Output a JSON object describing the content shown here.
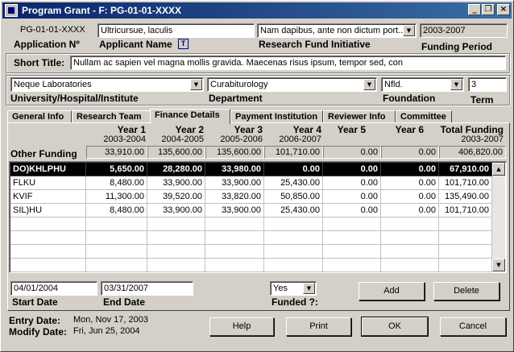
{
  "window": {
    "title": "Program Grant - F: PG-01-01-XXXX",
    "minimize_glyph": "_",
    "restore_glyph": "❐",
    "close_glyph": "×"
  },
  "header": {
    "application_no_value": "PG-01-01-XXXX",
    "application_no_label": "Application Nº",
    "applicant_name_value": "Ultricursue, laculis",
    "applicant_name_label": "Applicant Name",
    "applicant_icon_glyph": "T",
    "research_fund_value": "Nam dapibus, ante non dictum port...",
    "research_fund_label": "Research Fund Initiative",
    "funding_period_value": "2003-2007",
    "funding_period_label": "Funding Period"
  },
  "short_title": {
    "label": "Short Title:",
    "value": "Nullam ac sapien vel magna mollis gravida. Maecenas risus ipsum, tempor sed, con"
  },
  "institution": {
    "university_value": "Neque Laboratories",
    "university_label": "University/Hospital/Institute",
    "department_value": "Curabiturology",
    "department_label": "Department",
    "foundation_value": "Nfld.",
    "foundation_label": "Foundation",
    "term_value": "3",
    "term_label": "Term"
  },
  "tabs": [
    {
      "label": "General Info"
    },
    {
      "label": "Research Team"
    },
    {
      "label": "Finance Details"
    },
    {
      "label": "Payment Institution"
    },
    {
      "label": "Reviewer Info"
    },
    {
      "label": "Committee"
    }
  ],
  "finance": {
    "columns": [
      {
        "year": "Year 1",
        "period": "2003-2004"
      },
      {
        "year": "Year 2",
        "period": "2004-2005"
      },
      {
        "year": "Year 3",
        "period": "2005-2006"
      },
      {
        "year": "Year 4",
        "period": "2006-2007"
      },
      {
        "year": "Year 5",
        "period": ""
      },
      {
        "year": "Year 6",
        "period": ""
      },
      {
        "year": "Total Funding",
        "period": "2003-2007"
      }
    ],
    "other_funding_label": "Other Funding",
    "other_funding": [
      "33,910.00",
      "135,600.00",
      "135,600.00",
      "101,710.00",
      "0.00",
      "0.00",
      "406,820.00"
    ],
    "rows": [
      {
        "name": "DO)KHLPHU",
        "values": [
          "5,650.00",
          "28,280.00",
          "33,980.00",
          "0.00",
          "0.00",
          "0.00",
          "67,910.00"
        ]
      },
      {
        "name": "FLKU",
        "values": [
          "8,480.00",
          "33,900.00",
          "33,900.00",
          "25,430.00",
          "0.00",
          "0.00",
          "101,710.00"
        ]
      },
      {
        "name": "KVIF",
        "values": [
          "11,300.00",
          "39,520.00",
          "33,820.00",
          "50,850.00",
          "0.00",
          "0.00",
          "135,490.00"
        ]
      },
      {
        "name": "SIL)HU",
        "values": [
          "8,480.00",
          "33,900.00",
          "33,900.00",
          "25,430.00",
          "0.00",
          "0.00",
          "101,710.00"
        ]
      }
    ],
    "scroll_up_glyph": "▲",
    "scroll_down_glyph": "▼",
    "start_date_value": "04/01/2004",
    "start_date_label": "Start Date",
    "end_date_value": "03/31/2007",
    "end_date_label": "End Date",
    "funded_value": "Yes",
    "funded_label": "Funded ?:",
    "add_label": "Add",
    "delete_label": "Delete"
  },
  "footer": {
    "entry_date_label": "Entry Date:",
    "entry_date_value": "Mon, Nov 17, 2003",
    "modify_date_label": "Modify Date:",
    "modify_date_value": "Fri, Jun 25, 2004",
    "help_label": "Help",
    "print_label": "Print",
    "ok_label": "OK",
    "cancel_label": "Cancel"
  },
  "combo_glyph": "▼"
}
